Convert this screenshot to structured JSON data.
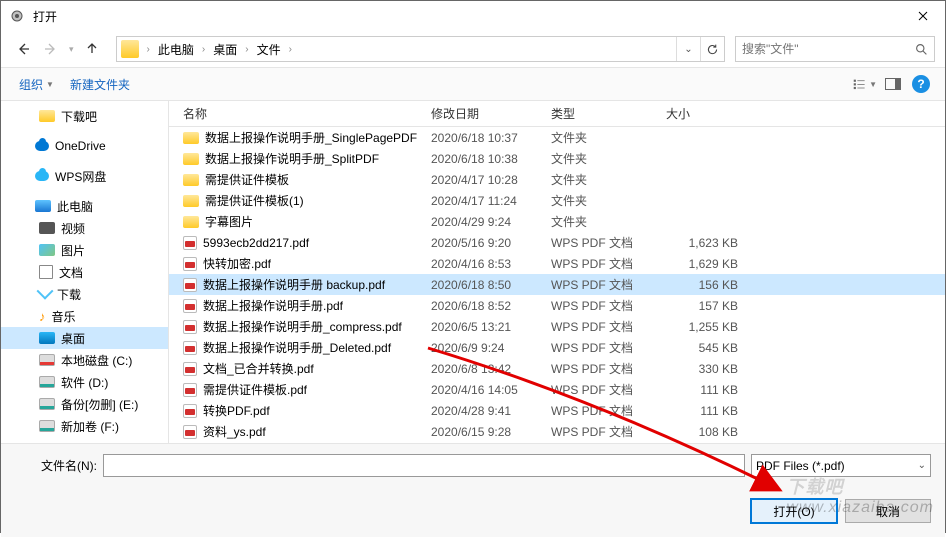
{
  "window": {
    "title": "打开"
  },
  "breadcrumbs": {
    "root": "此电脑",
    "part1": "桌面",
    "part2": "文件"
  },
  "search": {
    "placeholder": "搜索\"文件\""
  },
  "toolbar": {
    "organize": "组织",
    "newfolder": "新建文件夹"
  },
  "columns": {
    "name": "名称",
    "date": "修改日期",
    "type": "类型",
    "size": "大小"
  },
  "sidebar": {
    "download8": "下载吧",
    "onedrive": "OneDrive",
    "wps": "WPS网盘",
    "thispc": "此电脑",
    "video": "视频",
    "pictures": "图片",
    "documents": "文档",
    "downloads": "下载",
    "music": "音乐",
    "desktop": "桌面",
    "diskc": "本地磁盘 (C:)",
    "diskd": "软件 (D:)",
    "diske": "备份[勿删] (E:)",
    "diskf": "新加卷 (F:)"
  },
  "files": [
    {
      "name": "数据上报操作说明手册_SinglePagePDF",
      "date": "2020/6/18 10:37",
      "type": "文件夹",
      "size": "",
      "kind": "folder"
    },
    {
      "name": "数据上报操作说明手册_SplitPDF",
      "date": "2020/6/18 10:38",
      "type": "文件夹",
      "size": "",
      "kind": "folder"
    },
    {
      "name": "需提供证件模板",
      "date": "2020/4/17 10:28",
      "type": "文件夹",
      "size": "",
      "kind": "folder"
    },
    {
      "name": "需提供证件模板(1)",
      "date": "2020/4/17 11:24",
      "type": "文件夹",
      "size": "",
      "kind": "folder"
    },
    {
      "name": "字幕图片",
      "date": "2020/4/29 9:24",
      "type": "文件夹",
      "size": "",
      "kind": "folder"
    },
    {
      "name": "5993ecb2dd217.pdf",
      "date": "2020/5/16 9:20",
      "type": "WPS PDF 文档",
      "size": "1,623 KB",
      "kind": "pdf"
    },
    {
      "name": "快转加密.pdf",
      "date": "2020/4/16 8:53",
      "type": "WPS PDF 文档",
      "size": "1,629 KB",
      "kind": "pdf"
    },
    {
      "name": "数据上报操作说明手册 backup.pdf",
      "date": "2020/6/18 8:50",
      "type": "WPS PDF 文档",
      "size": "156 KB",
      "kind": "pdf",
      "selected": true
    },
    {
      "name": "数据上报操作说明手册.pdf",
      "date": "2020/6/18 8:52",
      "type": "WPS PDF 文档",
      "size": "157 KB",
      "kind": "pdf"
    },
    {
      "name": "数据上报操作说明手册_compress.pdf",
      "date": "2020/6/5 13:21",
      "type": "WPS PDF 文档",
      "size": "1,255 KB",
      "kind": "pdf"
    },
    {
      "name": "数据上报操作说明手册_Deleted.pdf",
      "date": "2020/6/9 9:24",
      "type": "WPS PDF 文档",
      "size": "545 KB",
      "kind": "pdf"
    },
    {
      "name": "文档_已合并转换.pdf",
      "date": "2020/6/8 13:42",
      "type": "WPS PDF 文档",
      "size": "330 KB",
      "kind": "pdf"
    },
    {
      "name": "需提供证件模板.pdf",
      "date": "2020/4/16 14:05",
      "type": "WPS PDF 文档",
      "size": "111 KB",
      "kind": "pdf"
    },
    {
      "name": "转换PDF.pdf",
      "date": "2020/4/28 9:41",
      "type": "WPS PDF 文档",
      "size": "111 KB",
      "kind": "pdf"
    },
    {
      "name": "资料_ys.pdf",
      "date": "2020/6/15 9:28",
      "type": "WPS PDF 文档",
      "size": "108 KB",
      "kind": "pdf"
    }
  ],
  "footer": {
    "filename_label": "文件名(N):",
    "filename_value": "",
    "filetype": "PDF Files (*.pdf)",
    "open": "打开(O)",
    "cancel": "取消"
  },
  "watermark": {
    "l1": "下载吧",
    "l2": "www.xiazaiba.com"
  }
}
